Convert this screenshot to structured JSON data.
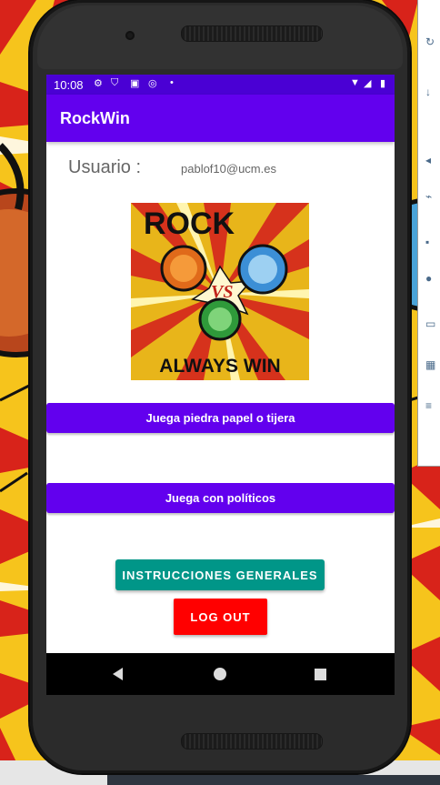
{
  "statusbar": {
    "time": "10:08",
    "icons": [
      "settings-icon",
      "shield-icon",
      "a-icon",
      "sync-icon",
      "dot-icon",
      "wifi-icon",
      "signal-icon",
      "battery-icon"
    ]
  },
  "appbar": {
    "title": "RockWin"
  },
  "user": {
    "label": "Usuario :",
    "email": "pablof10@ucm.es"
  },
  "logo": {
    "top_text": "ROCK",
    "middle_text": "VS",
    "bottom_text": "ALWAYS WIN"
  },
  "buttons": {
    "play_rps": "Juega piedra papel o tijera",
    "play_politicians": "Juega con políticos",
    "instructions": "INSTRUCCIONES GENERALES",
    "logout": "LOG OUT"
  },
  "colors": {
    "status_bar": "#4a00d4",
    "app_bar": "#6200ee",
    "primary_button": "#6200ee",
    "instructions_button": "#009688",
    "logout_button": "#ff0000"
  }
}
